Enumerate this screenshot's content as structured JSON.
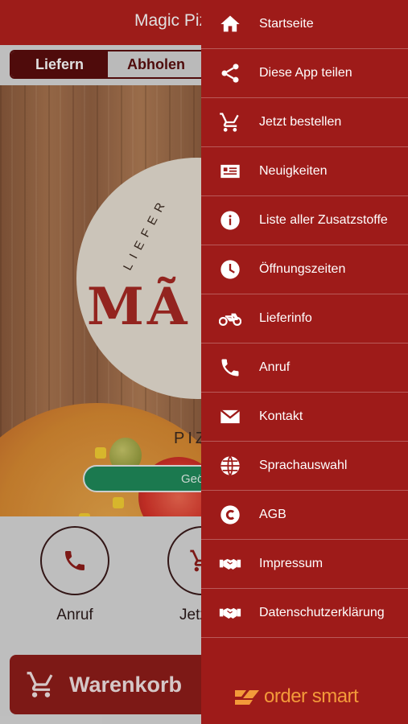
{
  "header": {
    "title": "Magic Piz"
  },
  "order_mode": {
    "options": [
      "Liefern",
      "Abholen"
    ],
    "selected": "Liefern"
  },
  "hero": {
    "logo_text": "MÃ",
    "logo_arc": "LIEFER",
    "logo_subtitle": "PIZ",
    "status": "Geö"
  },
  "actions": [
    {
      "label": "Anruf",
      "icon": "phone-icon"
    },
    {
      "label": "Jetzt b",
      "icon": "cart-icon"
    }
  ],
  "cart": {
    "label": "Warenkorb",
    "icon": "cart-icon"
  },
  "menu": {
    "items": [
      {
        "label": "Startseite",
        "icon": "home-icon"
      },
      {
        "label": "Diese App teilen",
        "icon": "share-icon"
      },
      {
        "label": "Jetzt bestellen",
        "icon": "cart-icon"
      },
      {
        "label": "Neuigkeiten",
        "icon": "news-icon"
      },
      {
        "label": "Liste aller Zusatzstoffe",
        "icon": "info-icon"
      },
      {
        "label": "Öffnungszeiten",
        "icon": "clock-icon"
      },
      {
        "label": "Lieferinfo",
        "icon": "motorcycle-icon"
      },
      {
        "label": "Anruf",
        "icon": "phone-icon"
      },
      {
        "label": "Kontakt",
        "icon": "mail-icon"
      },
      {
        "label": "Sprachauswahl",
        "icon": "globe-icon"
      },
      {
        "label": "AGB",
        "icon": "copyright-icon"
      },
      {
        "label": "Impressum",
        "icon": "handshake-icon"
      },
      {
        "label": "Datenschutzerklärung",
        "icon": "handshake-icon"
      }
    ]
  },
  "branding": {
    "text": "order smart"
  },
  "colors": {
    "primary": "#b3201d",
    "drawer": "#9e1b19",
    "accent": "#f39a3a",
    "status_green": "#1f8a5a"
  }
}
